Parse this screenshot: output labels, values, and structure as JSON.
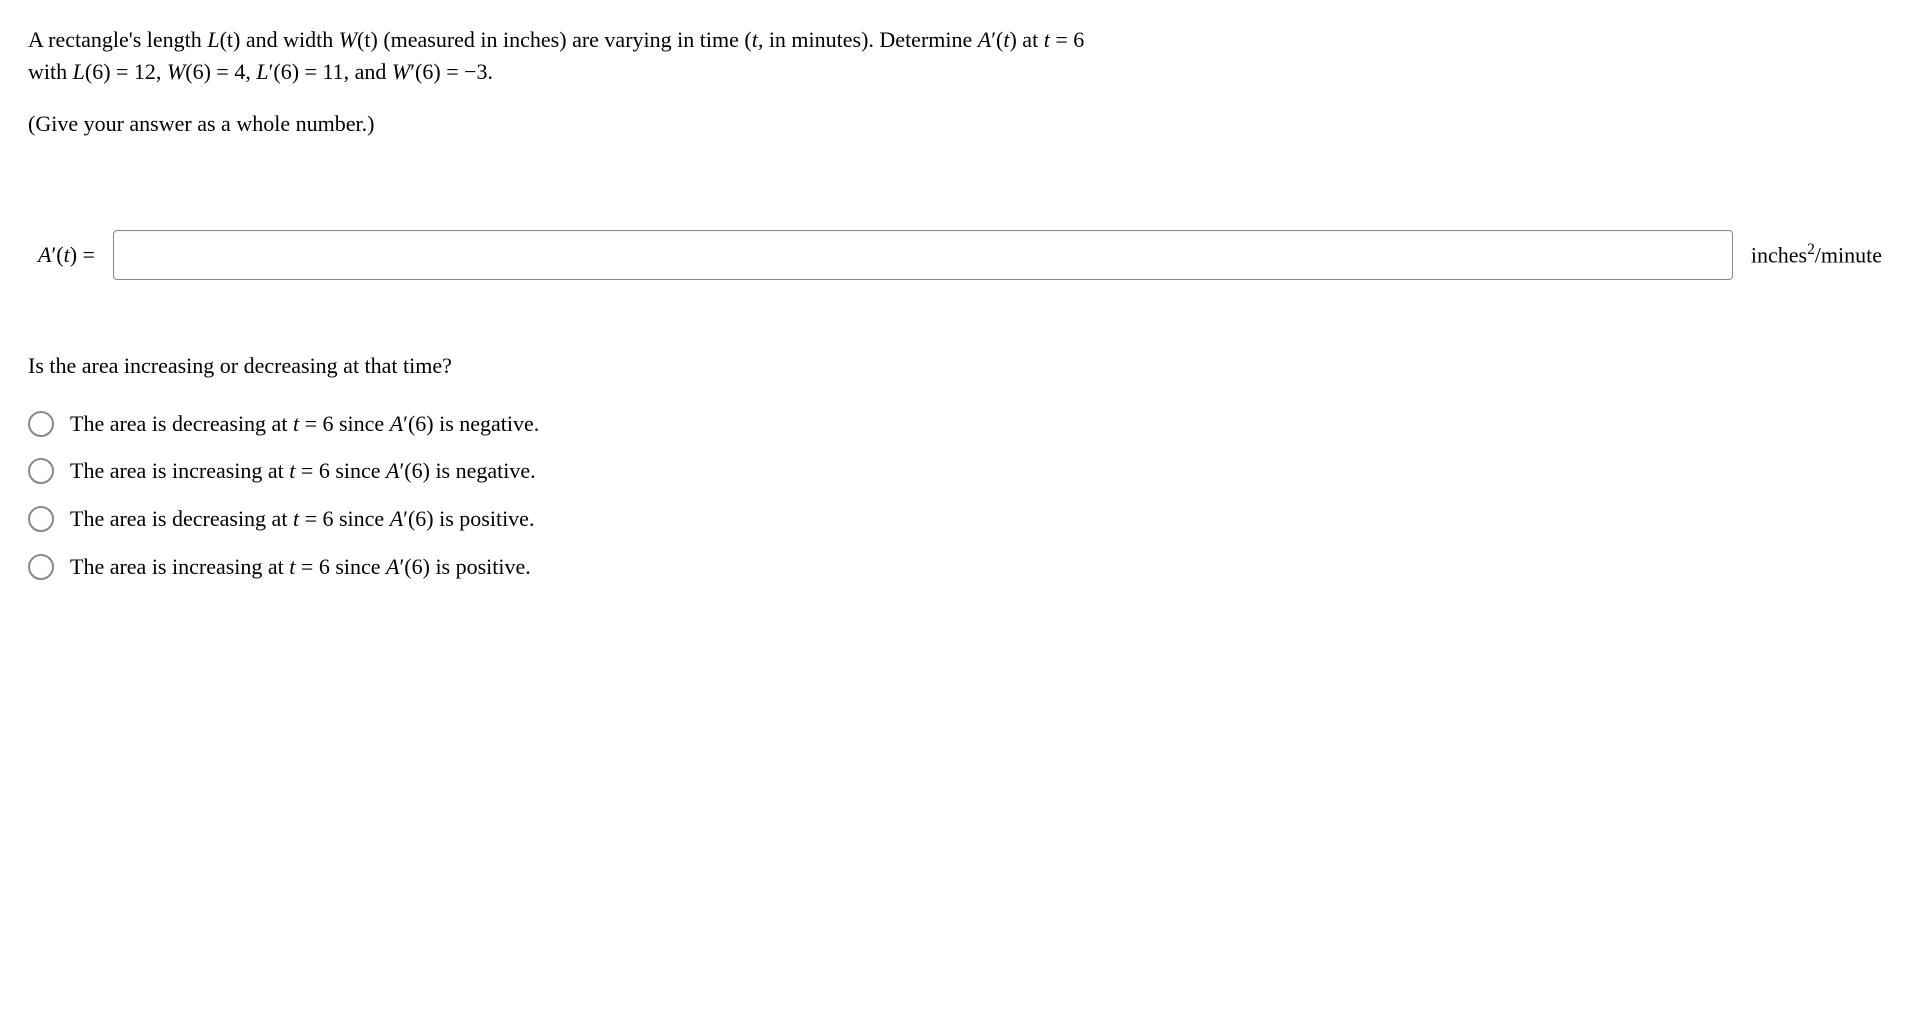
{
  "problem": {
    "line1_pre": "A rectangle's length ",
    "line1_L": "L",
    "line1_t1": "(t)",
    "line1_mid1": " and width ",
    "line1_W": "W",
    "line1_t2": "(t)",
    "line1_mid2": " (measured in inches) are varying in time (",
    "line1_tvar": "t",
    "line1_mid3": ", in minutes). Determine ",
    "line1_A": "A",
    "line1_prime1": "′(",
    "line1_tvar2": "t",
    "line1_post1": ") at ",
    "line1_tvar3": "t",
    "line1_eq": " = 6",
    "line2_pre": "with ",
    "line2_L": "L",
    "line2_v1": "(6) = 12, ",
    "line2_W": "W",
    "line2_v2": "(6) = 4, ",
    "line2_Lp": "L",
    "line2_v3": "′(6) = 11, and ",
    "line2_Wp": "W",
    "line2_v4": "′(6) = −3."
  },
  "instruction": "(Give your answer as a whole number.)",
  "answer": {
    "label_A": "A",
    "label_rest": "′(",
    "label_t": "t",
    "label_close": ") =",
    "unit_pre": "inches",
    "unit_sup": "2",
    "unit_post": "/minute"
  },
  "question2": "Is the area increasing or decreasing at that time?",
  "options": [
    {
      "pre": "The area is decreasing at ",
      "t": "t",
      "mid": " = 6 since ",
      "A": "A",
      "post": "′(6) is negative."
    },
    {
      "pre": "The area is increasing at ",
      "t": "t",
      "mid": " = 6 since ",
      "A": "A",
      "post": "′(6) is negative."
    },
    {
      "pre": "The area is decreasing at ",
      "t": "t",
      "mid": " = 6 since ",
      "A": "A",
      "post": "′(6) is positive."
    },
    {
      "pre": "The area is increasing at ",
      "t": "t",
      "mid": " = 6 since ",
      "A": "A",
      "post": "′(6) is positive."
    }
  ]
}
